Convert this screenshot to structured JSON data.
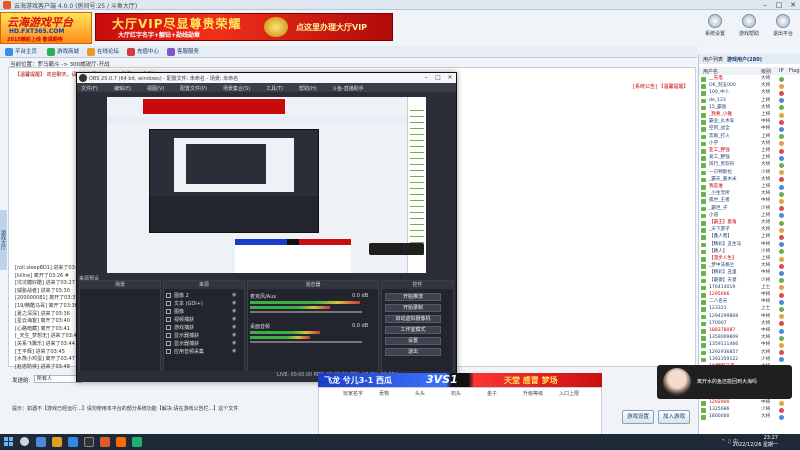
{
  "window": {
    "title": "云海游戏客户端 4.0.0 (房间号:25 / 斗鱼大厅)"
  },
  "logo": {
    "line1": "云海游戏平台",
    "line2": "HD.FXT365.COM",
    "line3": "2015精彩上线 敬请期待"
  },
  "banner": {
    "main": "大厅VIP尽显尊贵荣耀",
    "sub": "大厅红字名字+靓钻+勋线勋章",
    "cta": "点这里办理大厅VIP"
  },
  "top_icons": [
    {
      "label": "系统设置"
    },
    {
      "label": "游戏帮助"
    },
    {
      "label": "退出平台"
    }
  ],
  "toolbar": [
    {
      "label": "平台主页"
    },
    {
      "label": "游戏商城"
    },
    {
      "label": "在线论坛"
    },
    {
      "label": "充值中心"
    },
    {
      "label": "客服服务"
    }
  ],
  "location": "当前位置：罗马霸斗 -> 300威锐厅-开战",
  "chat": {
    "system_line": "【温馨提醒】 欢迎聊天，请大家文明发言，禁止刷屏等违规行为。",
    "system_right": "[系统公告] 【温馨提醒】",
    "messages": [
      "[roll.sleep8D1] 进来了03:24",
      "[kiline] 离开了03:26 #  ",
      "[坑坑糖好酷] 进来了03:27",
      "[威胁战者] 进来了03:30",
      "[200000081] 离开了03:35",
      "[19/精酷马哥] 离开了03:36",
      "[夏之深深] 进来了03:36",
      "[星云海客] 离开了03:40",
      "[心路暗藏] 离开了03:41",
      "[_天生_梦想无] 进来了03:42",
      "[关系飞翼乐] 进来了03:44",
      "[王平辉] 进来了03:45",
      "[水熊小鸡蛋] 离开了03:47",
      "[赵忠防侠] 进来了03:48"
    ]
  },
  "send": {
    "label": "发送给:",
    "target": "所有人"
  },
  "bottom_hint": "提示：如遇不【游戏已经运行...】请勿使用本平台的部分系统功能【解决:请在游戏公告栏...】这个文件",
  "buttons": {
    "settings": "游戏设置",
    "join": "加入游戏"
  },
  "user_panel": {
    "tabs": [
      "用户列表",
      "游戏用户(280)"
    ],
    "headers": [
      "用户名",
      "级别",
      "IP",
      "Flag"
    ],
    "users": [
      {
        "name": "__先电",
        "level": "大将"
      },
      {
        "name": "OK_刻五000",
        "level": "大将"
      },
      {
        "name": "100_中人",
        "level": "大将"
      },
      {
        "name": "de_123",
        "level": "上将"
      },
      {
        "name": "15_霸恩",
        "level": "大将"
      },
      {
        "name": "_我要_小雅",
        "level": "上将"
      },
      {
        "name": "霸业_炎木军",
        "level": "中将"
      },
      {
        "name": "空阿_战全",
        "level": "中将"
      },
      {
        "name": "恋眼_打火",
        "level": "上将"
      },
      {
        "name": "小学",
        "level": "大将"
      },
      {
        "name": "亚工_野强",
        "level": "上将"
      },
      {
        "name": "爱工_野强",
        "level": "上将"
      },
      {
        "name": "风行_贵欢符",
        "level": "大将"
      },
      {
        "name": "一只特斯拉",
        "level": "少将"
      },
      {
        "name": "_霸天_嘉木米",
        "level": "大将"
      },
      {
        "name": "我是谁",
        "level": "上将"
      },
      {
        "name": "_小生无所",
        "level": "大将"
      },
      {
        "name": "孤世_王者",
        "level": "中将"
      },
      {
        "name": "_霸世_子",
        "level": "少将"
      },
      {
        "name": "小道",
        "level": "上将"
      },
      {
        "name": "【霸王】菱角",
        "level": "大将"
      },
      {
        "name": "_天下游子",
        "level": "大将"
      },
      {
        "name": "【鑫人而】",
        "level": "上将"
      },
      {
        "name": "【精彩】丑生马",
        "level": "中将"
      },
      {
        "name": "【路人】",
        "level": "少将"
      },
      {
        "name": "【漫步人生】",
        "level": "上将"
      },
      {
        "name": "_梦中法格兰",
        "level": "大将"
      },
      {
        "name": "【精彩】丑里",
        "level": "中将"
      },
      {
        "name": "【霸傲】天意",
        "level": "少将"
      },
      {
        "name": "176414019",
        "level": "上士"
      },
      {
        "name": "1295666",
        "level": "中将"
      },
      {
        "name": "二八名天",
        "level": "中将"
      },
      {
        "name": "123321",
        "level": "上士"
      },
      {
        "name": "1294299868",
        "level": "中将"
      },
      {
        "name": "170007",
        "level": "大将"
      },
      {
        "name": "188378087",
        "level": "中将"
      },
      {
        "name": "1359009809",
        "level": "大将"
      },
      {
        "name": "1359111466",
        "level": "中将"
      },
      {
        "name": "1292936857",
        "level": "大将"
      },
      {
        "name": "1392359122",
        "level": "少将"
      },
      {
        "name": "19/精酷马哥",
        "level": "大将"
      },
      {
        "name": "1295821904",
        "level": "大将"
      },
      {
        "name": "17800304",
        "level": "大将"
      },
      {
        "name": "1785248",
        "level": "上士"
      },
      {
        "name": "1772000002",
        "level": "大将"
      },
      {
        "name": "1292900",
        "level": "中将"
      },
      {
        "name": "1325686",
        "level": "少将"
      },
      {
        "name": "1800000",
        "level": "大将"
      }
    ]
  },
  "obs": {
    "title": "OBS 25.0.7 (64 bit, windows) - 配置文件: 未命名 - 场景: 未命名",
    "menu": [
      "文件(F)",
      "编辑(E)",
      "视图(V)",
      "配置文件(P)",
      "场景集合(S)",
      "工具(T)",
      "帮助(H)",
      "斗鱼-直播助手"
    ],
    "preview_label": "来源预设",
    "dock_headers": [
      "场景",
      "来源",
      "混音器",
      "转场",
      "控件"
    ],
    "sources": [
      "图像 2",
      "文本 (GDI+)",
      "图像",
      "视频捕获",
      "游戏捕获",
      "显示器捕获",
      "显示器捕获",
      "应用音频采集"
    ],
    "mixer": [
      {
        "name": "桌面音频",
        "db": "0.0 dB"
      },
      {
        "name": "麦克风/Aux",
        "db": "0.0 dB"
      }
    ],
    "controls": [
      "开始推流",
      "开始录制",
      "启动虚拟摄像机",
      "工作室模式",
      "设置",
      "退出"
    ],
    "status": "LIVE: 00:00:00   REC: 00:00:00   CPU: 12.0%, 60.00 fps"
  },
  "vs": {
    "left": "飞龙 兮儿3-1 西瓜",
    "center": "3VS1",
    "right": "天堂 感冒 梦场",
    "table_headers": [
      "玩家名字",
      "贡物",
      "头头",
      "石头",
      "金子",
      "升级等级",
      "入口上限"
    ]
  },
  "toast": {
    "text": "离开水的鱼还能回到大海吗"
  },
  "taskbar": {
    "time": "23:27",
    "date": "2022/12/26 星期一"
  }
}
